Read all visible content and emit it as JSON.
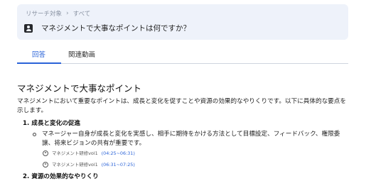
{
  "question_card": {
    "breadcrumb": {
      "root": "リサーチ対象",
      "separator": "›",
      "current": "すべて"
    },
    "question": "マネジメントで大事なポイントは何ですか？"
  },
  "tabs": [
    {
      "label": "回答",
      "active": true
    },
    {
      "label": "関連動画",
      "active": false
    }
  ],
  "answer": {
    "title": "マネジメントで大事なポイント",
    "intro": "マネジメントにおいて重要なポイントは、成長と変化を促すことや資源の効果的なやりくりです。以下に具体的な要点を示します。",
    "sections": [
      {
        "heading": "1. 成長と変化の促進",
        "bullet": "マネージャー自身が成長と変化を実感し、相手に期待をかける方法として目標設定、フィードバック、権限委譲、将来ビジョンの共有が重要です。",
        "videos": [
          {
            "title": "マネジメント研修vol1",
            "time": "(04:25~06:31)"
          },
          {
            "title": "マネジメント研修vol1",
            "time": "(06:31~07:25)"
          }
        ]
      },
      {
        "heading": "2. 資源の効果的なやりくり"
      }
    ]
  },
  "colors": {
    "accent": "#2a63d8",
    "card_bg": "#eef2fa"
  }
}
